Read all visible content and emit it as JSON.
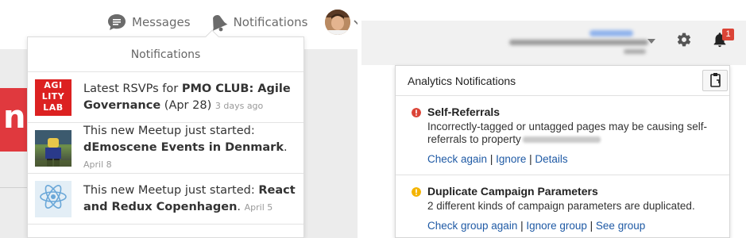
{
  "meetup": {
    "nav": {
      "messages_label": "Messages",
      "notifications_label": "Notifications"
    },
    "background_fragment": "n",
    "dropdown": {
      "title": "Notifications",
      "items": [
        {
          "thumb_lines": [
            "AGI",
            "LITY",
            "LAB"
          ],
          "text_prefix": "Latest RSVPs for ",
          "text_bold": "PMO CLUB: Agile Governance",
          "text_suffix": " (Apr 28)",
          "when": "3 days ago"
        },
        {
          "text_prefix": "This new Meetup just started: ",
          "text_bold": "dEmoscene Events in Denmark",
          "text_suffix": ".",
          "when": "April 8"
        },
        {
          "text_prefix": "This new Meetup just started: ",
          "text_bold": "React and Redux Copenhagen",
          "text_suffix": ".",
          "when": "April 5"
        }
      ]
    }
  },
  "analytics": {
    "badge_count": "1",
    "panel": {
      "title": "Analytics Notifications",
      "items": [
        {
          "severity": "error",
          "severity_color": "#db4437",
          "title": "Self-Referrals",
          "description": "Incorrectly-tagged or untagged pages may be causing self-referrals to property",
          "links": [
            "Check again",
            "Ignore",
            "Details"
          ]
        },
        {
          "severity": "warning",
          "severity_color": "#f4b400",
          "title": "Duplicate Campaign Parameters",
          "description": "2 different kinds of campaign parameters are duplicated.",
          "links": [
            "Check group again",
            "Ignore group",
            "See group"
          ]
        }
      ]
    }
  },
  "colors": {
    "meetup_red": "#e0393e",
    "link_blue": "#1f5aa5",
    "badge_red": "#db4437"
  }
}
